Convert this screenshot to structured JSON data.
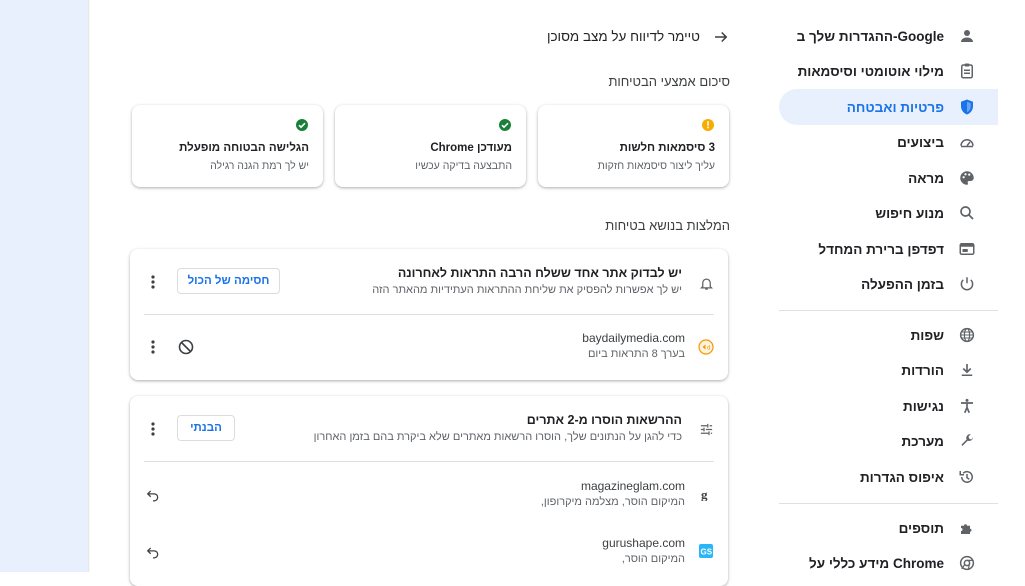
{
  "sidebar": {
    "items": [
      {
        "label": "ההגדרות שלך ב-Google",
        "icon": "person-icon"
      },
      {
        "label": "מילוי אוטומטי וסיסמאות",
        "icon": "clipboard-icon"
      },
      {
        "label": "פרטיות ואבטחה",
        "icon": "shield-icon",
        "active": true
      },
      {
        "label": "ביצועים",
        "icon": "speedometer-icon"
      },
      {
        "label": "מראה",
        "icon": "palette-icon"
      },
      {
        "label": "מנוע חיפוש",
        "icon": "search-icon"
      },
      {
        "label": "דפדפן ברירת המחדל",
        "icon": "browser-icon"
      },
      {
        "label": "בזמן ההפעלה",
        "icon": "power-icon"
      },
      {
        "label": "שפות",
        "icon": "globe-icon"
      },
      {
        "label": "הורדות",
        "icon": "download-icon"
      },
      {
        "label": "נגישות",
        "icon": "accessibility-icon"
      },
      {
        "label": "מערכת",
        "icon": "wrench-icon"
      },
      {
        "label": "איפוס הגדרות",
        "icon": "history-icon"
      },
      {
        "label": "תוספים",
        "icon": "puzzle-icon"
      },
      {
        "label": "מידע כללי על Chrome",
        "icon": "chrome-icon"
      }
    ]
  },
  "header": {
    "title": "טיימר לדיווח על מצב מסוכן"
  },
  "summary": {
    "title": "סיכום אמצעי הבטיחות",
    "cards": [
      {
        "title": "3 סיסמאות חלשות",
        "sub": "עליך ליצור סיסמאות חזקות",
        "status": "warning"
      },
      {
        "title": "מעודכן Chrome",
        "sub": "התבצעה בדיקה עכשיו",
        "status": "ok"
      },
      {
        "title": "הגלישה הבטוחה מופעלת",
        "sub": "יש לך רמת הגנה רגילה",
        "status": "ok"
      }
    ]
  },
  "recommendations": {
    "title": "המלצות בנושא בטיחות",
    "notifications": {
      "title": "יש לבדוק אתר אחד ששלח הרבה התראות לאחרונה",
      "sub": "יש לך אפשרות להפסיק את שליחת ההתראות העתידיות מהאתר הזה",
      "button": "חסימה של הכול",
      "site": "baydailymedia.com",
      "site_sub": "בערך 8 התראות ביום"
    },
    "permissions": {
      "title": "ההרשאות הוסרו מ-2 אתרים",
      "sub": "כדי להגן על הנתונים שלך, הוסרו הרשאות מאתרים שלא ביקרת בהם בזמן האחרון",
      "button": "הבנתי",
      "sites": [
        {
          "name": "magazineglam.com",
          "sub": "המיקום הוסר,  מצלמה  מיקרופון,"
        },
        {
          "name": "gurushape.com",
          "sub": "המיקום הוסר,"
        }
      ]
    }
  },
  "colors": {
    "accent": "#1a73e8",
    "ok": "#188038",
    "warning": "#f9ab00"
  }
}
